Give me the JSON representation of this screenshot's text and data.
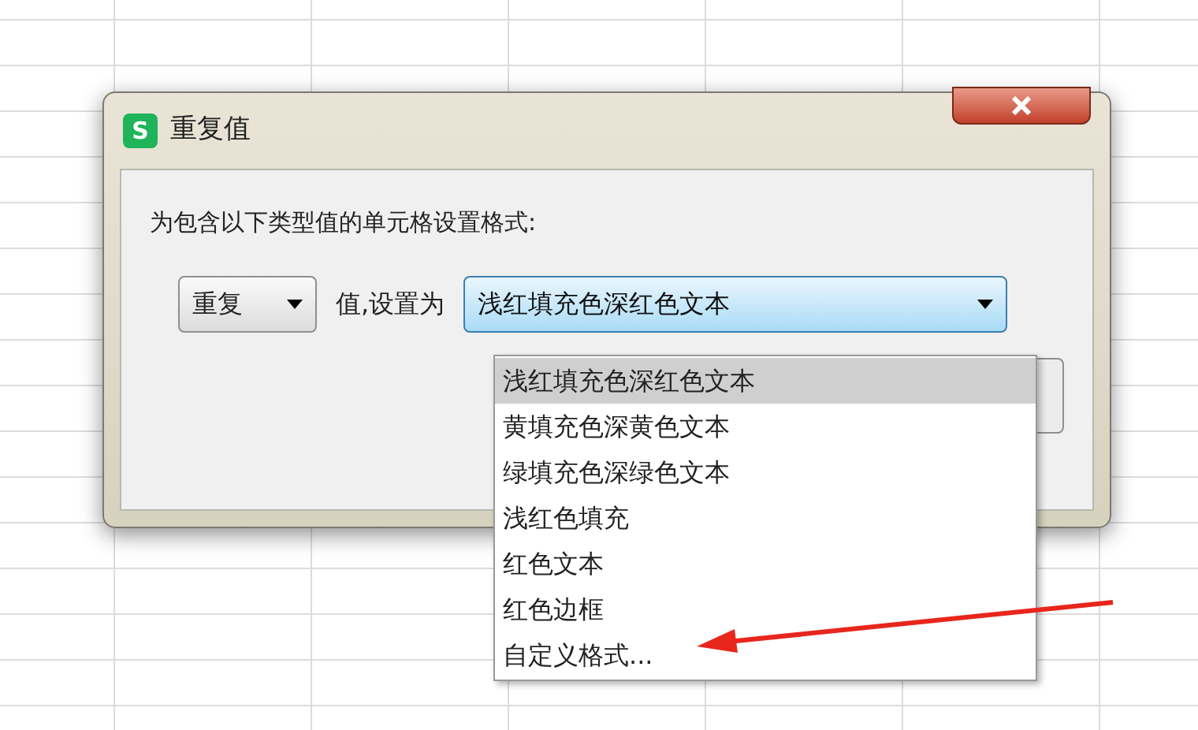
{
  "window": {
    "app_logo": "S",
    "title": "重复值"
  },
  "prompt": "为包含以下类型值的单元格设置格式:",
  "condition": {
    "value": "重复"
  },
  "label": "值,设置为",
  "format": {
    "value": "浅红填充色深红色文本",
    "expanded": true
  },
  "options": [
    {
      "label": "浅红填充色深红色文本",
      "selected": true
    },
    {
      "label": "黄填充色深黄色文本",
      "selected": false
    },
    {
      "label": "绿填充色深绿色文本",
      "selected": false
    },
    {
      "label": "浅红色填充",
      "selected": false
    },
    {
      "label": "红色文本",
      "selected": false
    },
    {
      "label": "红色边框",
      "selected": false
    },
    {
      "label": "自定义格式...",
      "selected": false
    }
  ]
}
